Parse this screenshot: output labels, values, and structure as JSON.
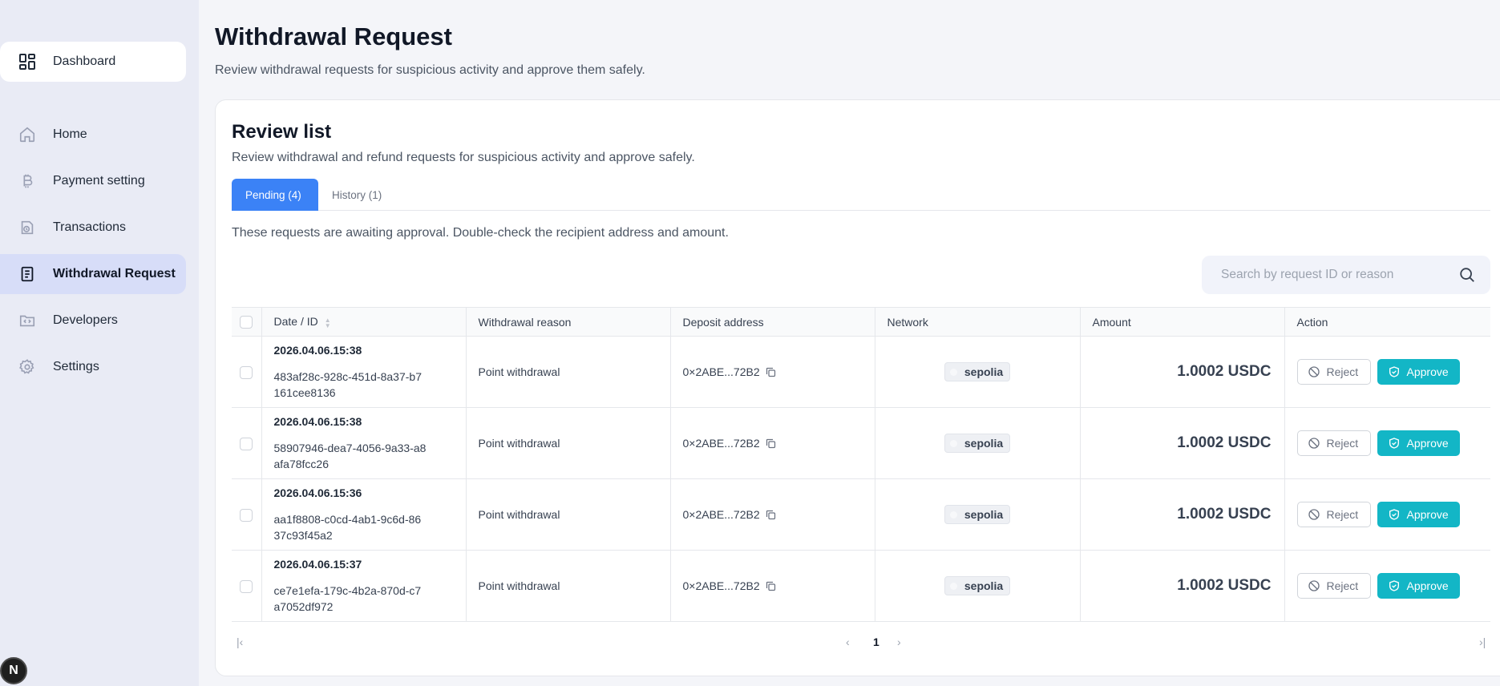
{
  "sidebar": {
    "dashboard": "Dashboard",
    "items": [
      {
        "label": "Home",
        "icon": "home-icon"
      },
      {
        "label": "Payment setting",
        "icon": "bitcoin-icon"
      },
      {
        "label": "Transactions",
        "icon": "transactions-icon"
      },
      {
        "label": "Withdrawal Request",
        "icon": "document-icon",
        "active": true
      },
      {
        "label": "Developers",
        "icon": "code-folder-icon"
      },
      {
        "label": "Settings",
        "icon": "gear-icon"
      }
    ],
    "badge": "N"
  },
  "header": {
    "title": "Withdrawal Request",
    "subtitle": "Review withdrawal requests for suspicious activity and approve them safely."
  },
  "review": {
    "title": "Review list",
    "subtitle": "Review withdrawal and refund requests for suspicious activity and approve safely.",
    "tabs": [
      {
        "label": "Pending (4)",
        "active": true
      },
      {
        "label": "History (1)",
        "active": false
      }
    ],
    "notice": "These requests are awaiting approval. Double-check the recipient address and amount.",
    "search": {
      "placeholder": "Search by request ID or reason",
      "value": ""
    },
    "columns": [
      "Date / ID",
      "Withdrawal reason",
      "Deposit address",
      "Network",
      "Amount",
      "Action"
    ],
    "rows": [
      {
        "date": "2026.04.06.15:38",
        "id": "483af28c-928c-451d-8a37-b7161cee8136",
        "reason": "Point withdrawal",
        "address": "0×2ABE...72B2",
        "network": "sepolia",
        "amount": "1.0002 USDC"
      },
      {
        "date": "2026.04.06.15:38",
        "id": "58907946-dea7-4056-9a33-a8afa78fcc26",
        "reason": "Point withdrawal",
        "address": "0×2ABE...72B2",
        "network": "sepolia",
        "amount": "1.0002 USDC"
      },
      {
        "date": "2026.04.06.15:36",
        "id": "aa1f8808-c0cd-4ab1-9c6d-8637c93f45a2",
        "reason": "Point withdrawal",
        "address": "0×2ABE...72B2",
        "network": "sepolia",
        "amount": "1.0002 USDC"
      },
      {
        "date": "2026.04.06.15:37",
        "id": "ce7e1efa-179c-4b2a-870d-c7a7052df972",
        "reason": "Point withdrawal",
        "address": "0×2ABE...72B2",
        "network": "sepolia",
        "amount": "1.0002 USDC"
      }
    ],
    "actions": {
      "reject": "Reject",
      "approve": "Approve"
    },
    "pagination": {
      "current": "1",
      "first": "|‹",
      "prev": "‹",
      "next": "›",
      "last": "›|"
    }
  },
  "colors": {
    "accent": "#3b82f6",
    "approve": "#13b6c6",
    "sidebar_bg": "#e9ebf5",
    "active_nav": "#d7ddf8"
  }
}
